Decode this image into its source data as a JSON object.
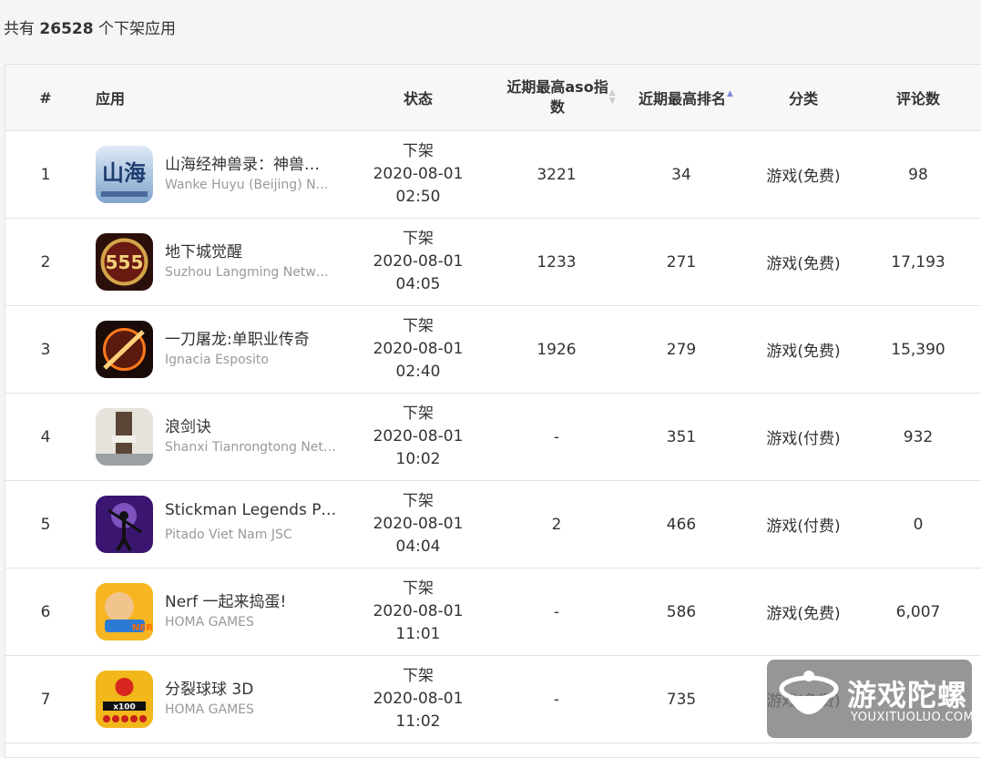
{
  "summary": {
    "prefix": "共有",
    "count": "26528",
    "suffix": "个下架应用"
  },
  "table": {
    "headers": {
      "rank": "#",
      "app": "应用",
      "status": "状态",
      "aso_line1": "近期最高aso指",
      "aso_line2": "数",
      "best_rank": "近期最高排名",
      "category": "分类",
      "reviews": "评论数"
    },
    "sort": {
      "aso": "inactive",
      "best_rank": "ascending"
    },
    "rows": [
      {
        "rank": "1",
        "name": "山海经神兽录：神兽…",
        "developer": "Wanke Huyu (Beijing) Net…",
        "status": "下架",
        "date": "2020-08-01",
        "time": "02:50",
        "aso": "3221",
        "best_rank": "34",
        "category": "游戏(免费)",
        "reviews": "98",
        "icon": "shanhaijing-app-icon"
      },
      {
        "rank": "2",
        "name": "地下城觉醒",
        "developer": "Suzhou Langming Netwo…",
        "status": "下架",
        "date": "2020-08-01",
        "time": "04:05",
        "aso": "1233",
        "best_rank": "271",
        "category": "游戏(免费)",
        "reviews": "17,193",
        "icon": "dungeon-awakening-app-icon"
      },
      {
        "rank": "3",
        "name": "一刀屠龙:单职业传奇",
        "developer": "Ignacia Esposito",
        "status": "下架",
        "date": "2020-08-01",
        "time": "02:40",
        "aso": "1926",
        "best_rank": "279",
        "category": "游戏(免费)",
        "reviews": "15,390",
        "icon": "dragon-slayer-app-icon"
      },
      {
        "rank": "4",
        "name": "浪剑诀",
        "developer": "Shanxi Tianrongtong Net…",
        "status": "下架",
        "date": "2020-08-01",
        "time": "10:02",
        "aso": "-",
        "best_rank": "351",
        "category": "游戏(付费)",
        "reviews": "932",
        "icon": "langjianjue-app-icon"
      },
      {
        "rank": "5",
        "name": "Stickman Legends Pr…",
        "developer": "Pitado Viet Nam JSC",
        "status": "下架",
        "date": "2020-08-01",
        "time": "04:04",
        "aso": "2",
        "best_rank": "466",
        "category": "游戏(付费)",
        "reviews": "0",
        "icon": "stickman-legends-app-icon"
      },
      {
        "rank": "6",
        "name": "Nerf 一起来捣蛋!",
        "developer": "HOMA GAMES",
        "status": "下架",
        "date": "2020-08-01",
        "time": "11:01",
        "aso": "-",
        "best_rank": "586",
        "category": "游戏(免费)",
        "reviews": "6,007",
        "icon": "nerf-app-icon"
      },
      {
        "rank": "7",
        "name": "分裂球球 3D",
        "developer": "HOMA GAMES",
        "status": "下架",
        "date": "2020-08-01",
        "time": "11:02",
        "aso": "-",
        "best_rank": "735",
        "category": "游戏(免费)",
        "reviews": "",
        "icon": "split-balls-app-icon"
      }
    ]
  },
  "watermark": {
    "title": "游戏陀螺",
    "subtitle": "YOUXITUOLUO.COM",
    "icon": "gyro-logo-icon"
  }
}
